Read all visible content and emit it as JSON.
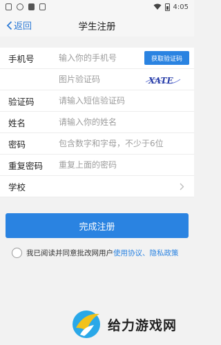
{
  "statusbar": {
    "time": "4:05"
  },
  "nav": {
    "back_label": "返回",
    "title": "学生注册"
  },
  "form": {
    "phone": {
      "label": "手机号",
      "placeholder": "输入你的手机号",
      "sms_button": "获取验证码"
    },
    "captcha": {
      "placeholder": "图片验证码",
      "captcha_text": "XATE"
    },
    "code": {
      "label": "验证码",
      "placeholder": "请输入短信验证码"
    },
    "name": {
      "label": "姓名",
      "placeholder": "请输入你的姓名"
    },
    "password": {
      "label": "密码",
      "placeholder": "包含数字和字母，不少于6位"
    },
    "repeat": {
      "label": "重复密码",
      "placeholder": "重复上面的密码"
    },
    "school": {
      "label": "学校"
    }
  },
  "submit_label": "完成注册",
  "agreement": {
    "prefix": "我已阅读并同意批改网用户",
    "link1": "使用协议",
    "separator": "、",
    "link2": "隐私政策"
  },
  "watermark": {
    "text": "给力游戏网"
  },
  "colors": {
    "accent": "#2a83e1",
    "back": "#2d7ad6",
    "background": "#f2f2f2"
  }
}
